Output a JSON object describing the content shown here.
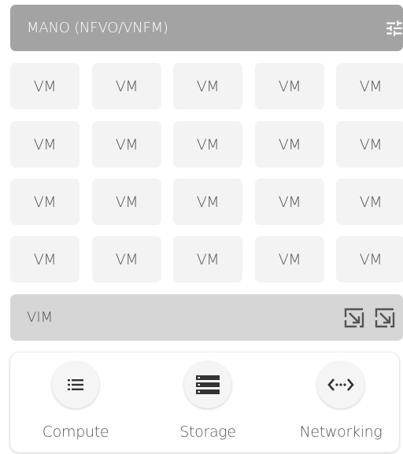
{
  "mano": {
    "title": "MANO (NFVO/VNFM)",
    "icon": "tune-icon"
  },
  "vms": [
    "VM",
    "VM",
    "VM",
    "VM",
    "VM",
    "VM",
    "VM",
    "VM",
    "VM",
    "VM",
    "VM",
    "VM",
    "VM",
    "VM",
    "VM",
    "VM",
    "VM",
    "VM",
    "VM",
    "VM"
  ],
  "vim": {
    "title": "VIM",
    "icons": [
      "open-in-full-icon",
      "open-in-full-icon"
    ]
  },
  "infrastructure": [
    {
      "label": "Compute",
      "icon": "list-icon"
    },
    {
      "label": "Storage",
      "icon": "storage-icon"
    },
    {
      "label": "Networking",
      "icon": "settings-ethernet-icon"
    }
  ],
  "colors": {
    "mano_bar": "#a3a3a3",
    "vim_bar": "#d6d6d6",
    "vm_tile": "#f3f3f3"
  }
}
